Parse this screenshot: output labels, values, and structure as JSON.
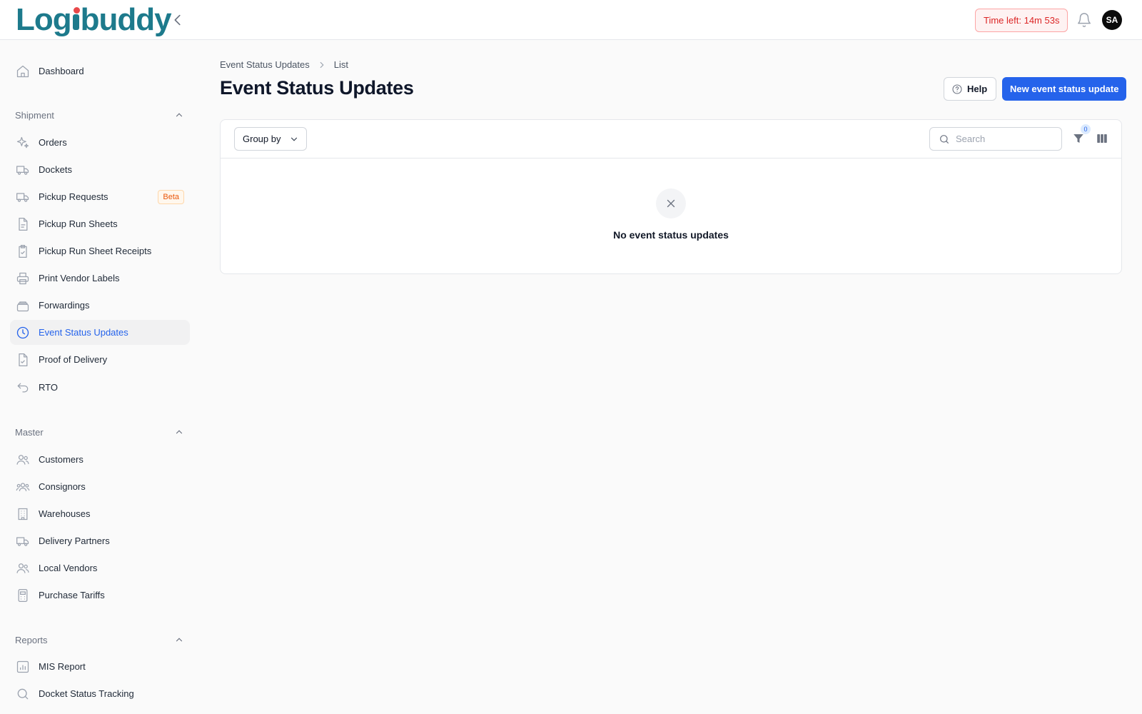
{
  "app": {
    "logo_text": "Logibuddy",
    "timer": "Time left: 14m 53s",
    "user_initials": "SA"
  },
  "sidebar": {
    "dashboard": "Dashboard",
    "sections": [
      {
        "title": "Shipment",
        "items": [
          {
            "label": "Orders",
            "icon": "sparkles-icon"
          },
          {
            "label": "Dockets",
            "icon": "truck-icon"
          },
          {
            "label": "Pickup Requests",
            "icon": "truck-icon",
            "badge": "Beta"
          },
          {
            "label": "Pickup Run Sheets",
            "icon": "document-icon"
          },
          {
            "label": "Pickup Run Sheet Receipts",
            "icon": "clipboard-check-icon"
          },
          {
            "label": "Print Vendor Labels",
            "icon": "printer-icon"
          },
          {
            "label": "Forwardings",
            "icon": "layers-icon"
          },
          {
            "label": "Event Status Updates",
            "icon": "clock-icon",
            "active": true
          },
          {
            "label": "Proof of Delivery",
            "icon": "document-check-icon"
          },
          {
            "label": "RTO",
            "icon": "return-arrow-icon"
          }
        ]
      },
      {
        "title": "Master",
        "items": [
          {
            "label": "Customers",
            "icon": "users-icon"
          },
          {
            "label": "Consignors",
            "icon": "user-group-icon"
          },
          {
            "label": "Warehouses",
            "icon": "building-icon"
          },
          {
            "label": "Delivery Partners",
            "icon": "truck-icon"
          },
          {
            "label": "Local Vendors",
            "icon": "users-icon"
          },
          {
            "label": "Purchase Tariffs",
            "icon": "calculator-icon"
          }
        ]
      },
      {
        "title": "Reports",
        "items": [
          {
            "label": "MIS Report",
            "icon": "bar-chart-icon"
          },
          {
            "label": "Docket Status Tracking",
            "icon": "search-icon"
          }
        ]
      }
    ]
  },
  "main": {
    "breadcrumb": [
      "Event Status Updates",
      "List"
    ],
    "title": "Event Status Updates",
    "help_label": "Help",
    "new_label": "New event status update",
    "group_by_label": "Group by",
    "search_placeholder": "Search",
    "filter_count": "0",
    "empty_message": "No event status updates"
  },
  "colors": {
    "accent": "#2563eb",
    "brand": "#1d7a8c",
    "logo_dot": "#e8484a",
    "timer_text": "#dc2626"
  }
}
